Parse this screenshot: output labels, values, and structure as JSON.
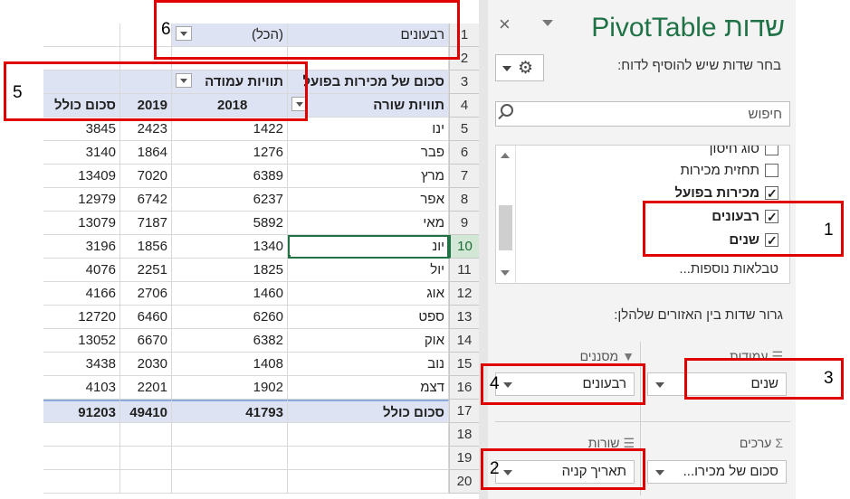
{
  "sheet": {
    "filter_row": {
      "field": "רבעונים",
      "value": "(הכל)"
    },
    "header_row3": {
      "title": "סכום של מכירות בפועל",
      "col_labels": "תוויות עמודה"
    },
    "header_row4": {
      "row_labels": "תוויות שורה",
      "col_2018": "2018",
      "col_2019": "2019",
      "col_total": "סכום כולל"
    },
    "rows": [
      {
        "month": "ינו",
        "y2018": "1422",
        "y2019": "2423",
        "total": "3845"
      },
      {
        "month": "פבר",
        "y2018": "1276",
        "y2019": "1864",
        "total": "3140"
      },
      {
        "month": "מרץ",
        "y2018": "6389",
        "y2019": "7020",
        "total": "13409"
      },
      {
        "month": "אפר",
        "y2018": "6237",
        "y2019": "6742",
        "total": "12979"
      },
      {
        "month": "מאי",
        "y2018": "5892",
        "y2019": "7187",
        "total": "13079"
      },
      {
        "month": "יונ",
        "y2018": "1340",
        "y2019": "1856",
        "total": "3196"
      },
      {
        "month": "יול",
        "y2018": "1825",
        "y2019": "2251",
        "total": "4076"
      },
      {
        "month": "אוג",
        "y2018": "1460",
        "y2019": "2706",
        "total": "4166"
      },
      {
        "month": "ספט",
        "y2018": "6260",
        "y2019": "6460",
        "total": "12720"
      },
      {
        "month": "אוק",
        "y2018": "6382",
        "y2019": "6670",
        "total": "13052"
      },
      {
        "month": "נוב",
        "y2018": "1408",
        "y2019": "2030",
        "total": "3438"
      },
      {
        "month": "דצמ",
        "y2018": "1902",
        "y2019": "2201",
        "total": "4103"
      }
    ],
    "grand_total": {
      "label": "סכום כולל",
      "y2018": "41793",
      "y2019": "49410",
      "total": "91203"
    },
    "row_numbers": [
      "1",
      "2",
      "3",
      "4",
      "5",
      "6",
      "7",
      "8",
      "9",
      "10",
      "11",
      "12",
      "13",
      "14",
      "15",
      "16",
      "17",
      "18",
      "19",
      "20"
    ]
  },
  "panel": {
    "title": "שדות PivotTable",
    "close_icon": "×",
    "choose_label": "בחר שדות שיש להוסיף לדוח:",
    "gear_icon": "⚙",
    "search_placeholder": "חיפוש",
    "fields": [
      {
        "label": "סוג חיסון",
        "checked": false,
        "bold": false
      },
      {
        "label": "תחזית מכירות",
        "checked": false,
        "bold": false
      },
      {
        "label": "מכירות בפועל",
        "checked": true,
        "bold": true
      },
      {
        "label": "רבעונים",
        "checked": true,
        "bold": true
      },
      {
        "label": "שנים",
        "checked": true,
        "bold": true
      }
    ],
    "more_tables": "טבלאות נוספות...",
    "drag_label": "גרור שדות בין האזורים שלהלן:",
    "areas": {
      "filters": {
        "label": "מסננים",
        "icon": "filter-icon",
        "item": "רבעונים"
      },
      "columns": {
        "label": "עמודות",
        "icon": "columns-icon",
        "item": "שנים"
      },
      "rows": {
        "label": "שורות",
        "icon": "rows-icon",
        "item": "תאריך קניה"
      },
      "values": {
        "label": "ערכים",
        "icon": "sigma-icon",
        "item": "סכום של מכירו..."
      }
    }
  },
  "annotations": [
    "1",
    "2",
    "3",
    "4",
    "5",
    "6"
  ],
  "colors": {
    "accent": "#1f7246",
    "annotation": "#e10000",
    "pivot_header": "#dde3f3"
  }
}
